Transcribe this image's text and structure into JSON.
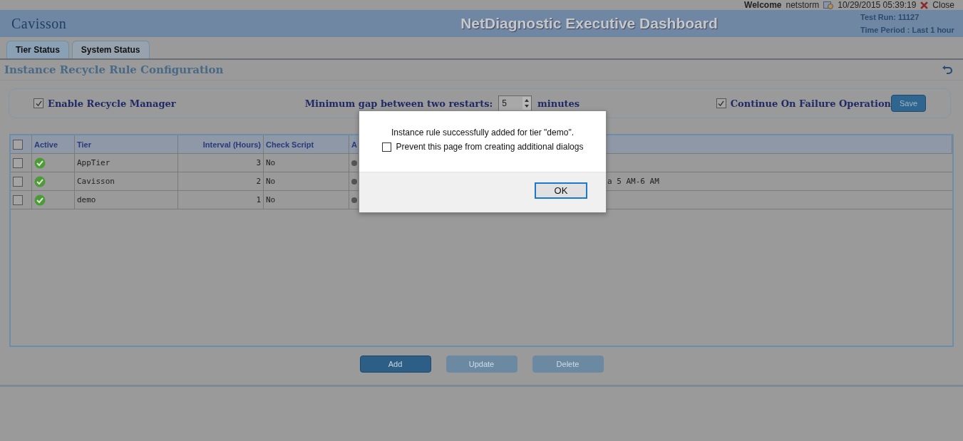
{
  "top_bar": {
    "welcome": "Welcome",
    "user": "netstorm",
    "datetime": "10/29/2015 05:39:19",
    "close": "Close"
  },
  "header": {
    "logo": "Cavisson",
    "title": "NetDiagnostic Executive Dashboard",
    "test_run": "Test Run: 11127",
    "time_period": "Time Period : Last 1 hour"
  },
  "tabs": [
    {
      "label": "Tier Status",
      "selected": true
    },
    {
      "label": "System Status",
      "selected": false
    }
  ],
  "section_title": "Instance Recycle Rule Configuration",
  "config": {
    "enable_recycle": {
      "label": "Enable Recycle Manager",
      "checked": true
    },
    "gap_label": "Minimum gap between two restarts:",
    "gap_value": "5",
    "gap_unit": "minutes",
    "continue_on_failure": {
      "label": "Continue On Failure Operation",
      "checked": true
    },
    "save": "Save"
  },
  "table": {
    "select_all_checked": false,
    "columns": [
      "Active",
      "Tier",
      "Interval (Hours)",
      "Check Script",
      "A"
    ],
    "rows": [
      {
        "checked": false,
        "active": true,
        "tier": "AppTier",
        "interval": "3",
        "check_script": "No"
      },
      {
        "checked": false,
        "active": true,
        "tier": "Cavisson",
        "interval": "2",
        "check_script": "No",
        "column_6": "a 5 AM-6 AM"
      },
      {
        "checked": false,
        "active": true,
        "tier": "demo",
        "interval": "1",
        "check_script": "No"
      }
    ]
  },
  "buttons": [
    {
      "label": "Add",
      "disabled": false
    },
    {
      "label": "Update",
      "disabled": true
    },
    {
      "label": "Delete",
      "disabled": true
    }
  ],
  "dialog": {
    "message": "Instance rule successfully added for tier \"demo\".",
    "prevent": {
      "label": "Prevent this page from creating additional dialogs",
      "checked": false
    },
    "ok": "OK"
  }
}
